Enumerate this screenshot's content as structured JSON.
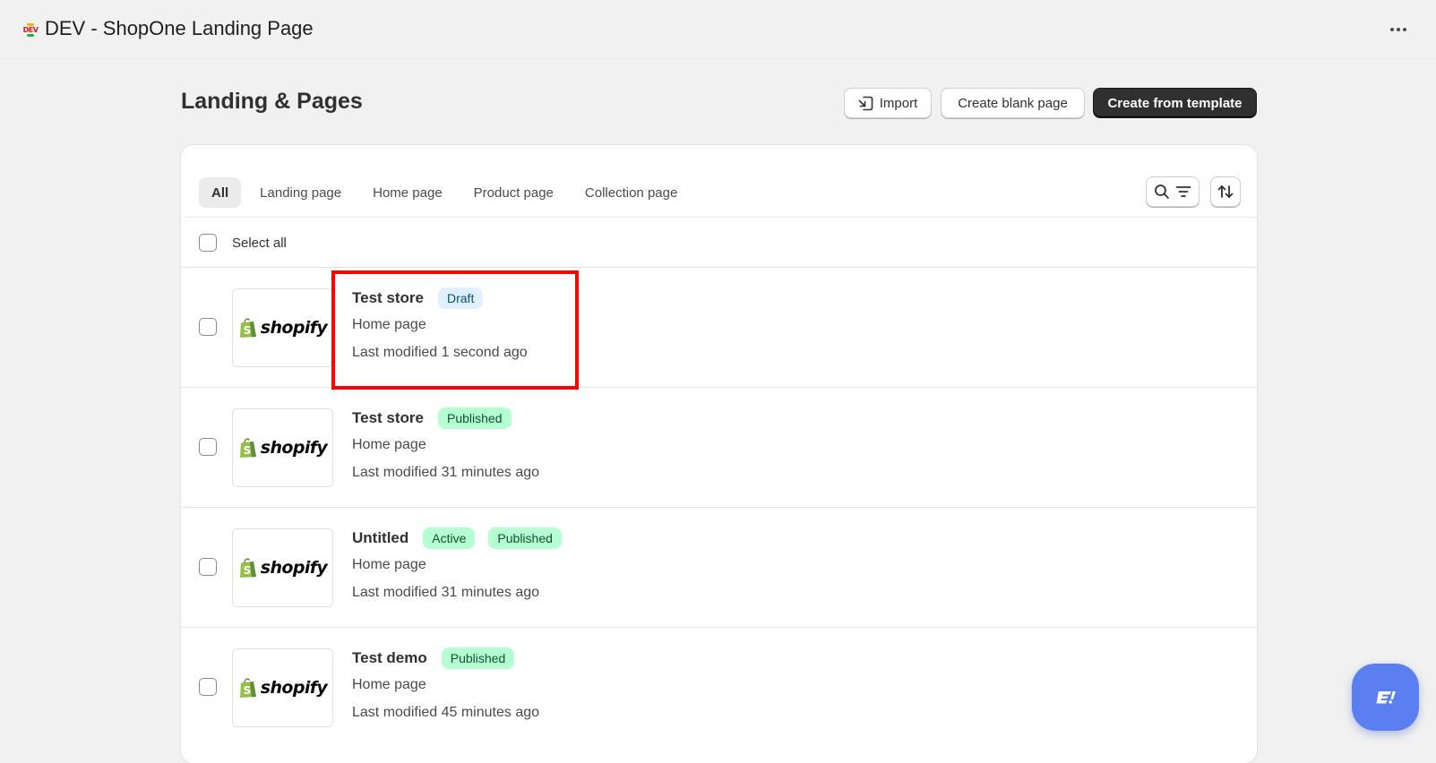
{
  "topbar": {
    "app_logo_text": "DEV",
    "title": "DEV - ShopOne Landing Page",
    "more_icon": "ellipsis-icon"
  },
  "header": {
    "title": "Landing & Pages",
    "import_label": "Import",
    "blank_label": "Create blank page",
    "template_label": "Create from template"
  },
  "tabs": [
    {
      "label": "All",
      "active": true
    },
    {
      "label": "Landing page"
    },
    {
      "label": "Home page"
    },
    {
      "label": "Product page"
    },
    {
      "label": "Collection page"
    }
  ],
  "select_all_label": "Select all",
  "thumbnail_brand": "shopify",
  "pages": [
    {
      "title": "Test store",
      "badges": [
        "Draft"
      ],
      "type": "Home page",
      "modified": "Last modified 1 second ago"
    },
    {
      "title": "Test store",
      "badges": [
        "Published"
      ],
      "type": "Home page",
      "modified": "Last modified 31 minutes ago"
    },
    {
      "title": "Untitled",
      "badges": [
        "Active",
        "Published"
      ],
      "type": "Home page",
      "modified": "Last modified 31 minutes ago"
    },
    {
      "title": "Test demo",
      "badges": [
        "Published"
      ],
      "type": "Home page",
      "modified": "Last modified 45 minutes ago"
    }
  ],
  "colors": {
    "primary_button": "#303030",
    "draft_badge_bg": "#e0f0ff",
    "published_badge_bg": "#b4fed2",
    "highlight": "#ff0000",
    "chat_button": "#5b7ff0",
    "shopify_green": "#95bf47"
  }
}
